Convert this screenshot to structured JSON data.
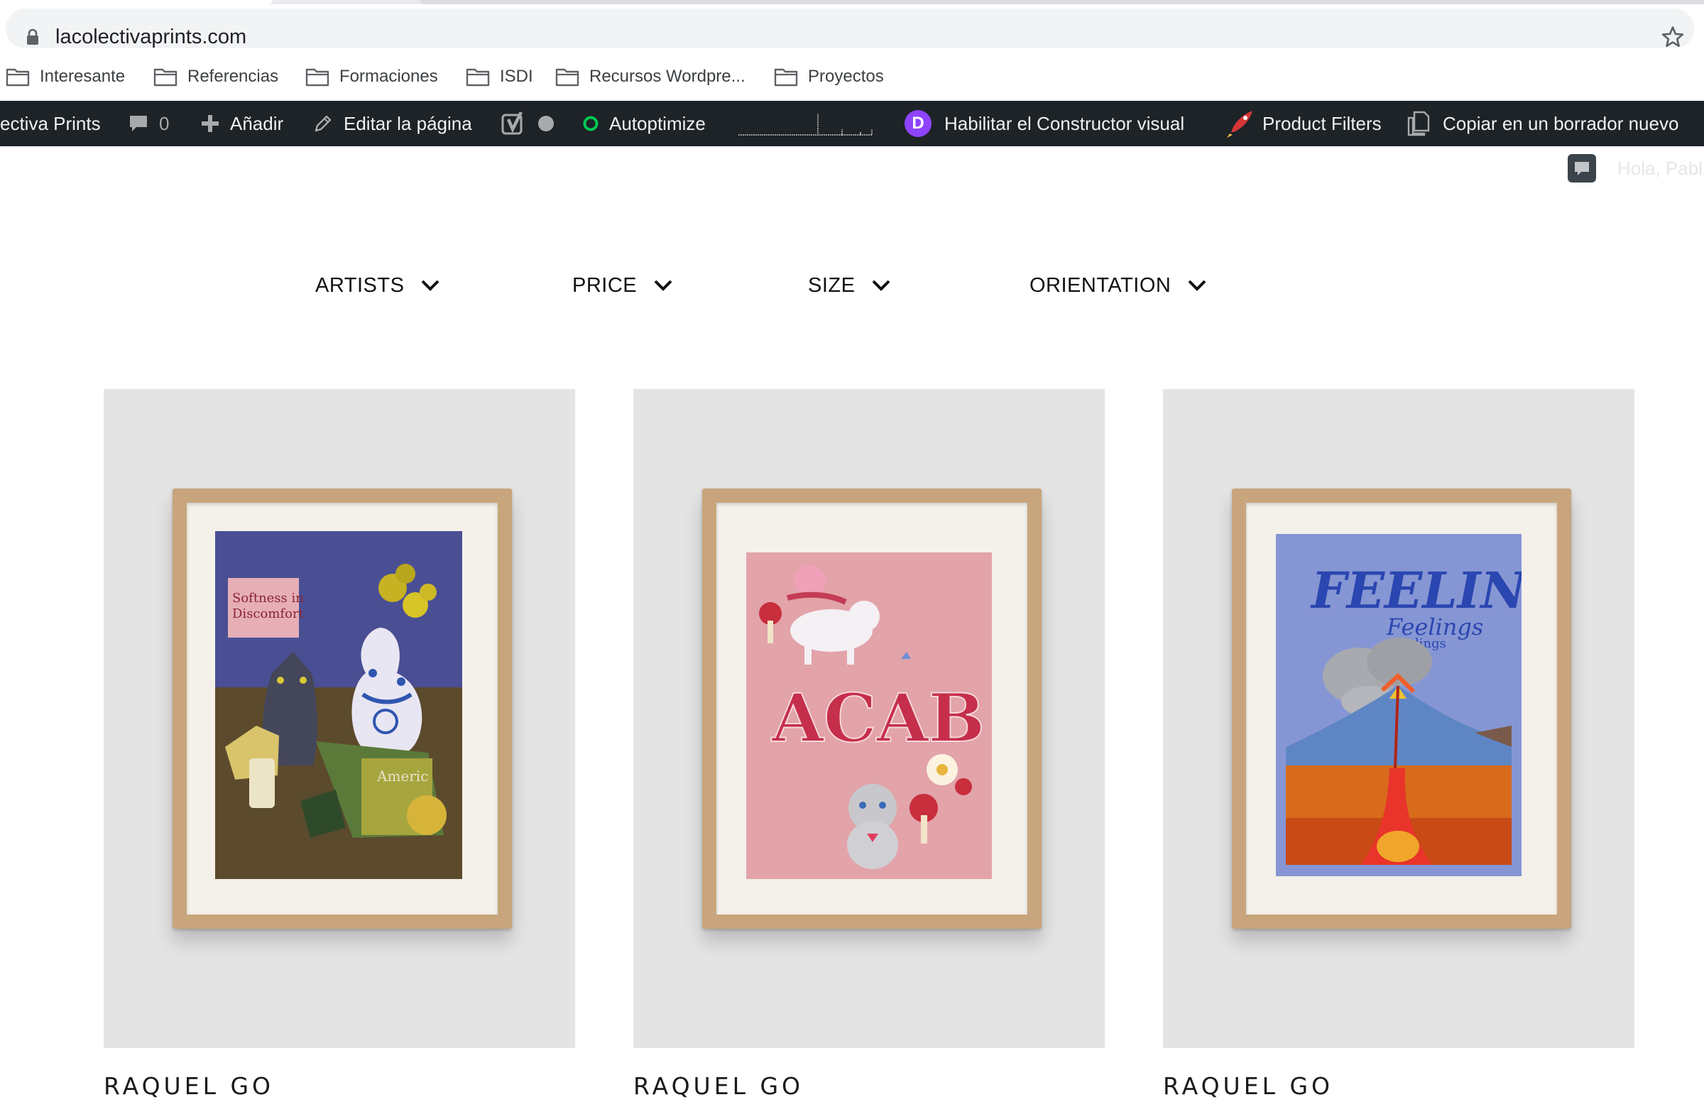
{
  "browser": {
    "url": "lacolectivaprints.com",
    "bookmarks": [
      "Interesante",
      "Referencias",
      "Formaciones",
      "ISDI",
      "Recursos Wordpre...",
      "Proyectos"
    ]
  },
  "adminbar": {
    "site_name": "ectiva Prints",
    "comments_count": "0",
    "add_label": "Añadir",
    "edit_label": "Editar la página",
    "autoptimize_label": "Autoptimize",
    "divi_label": "Habilitar el Constructor visual",
    "divi_badge": "D",
    "product_filters_label": "Product Filters",
    "copy_label": "Copiar en un borrador nuevo"
  },
  "page": {
    "greeting": "Hola, Pabl",
    "filters": [
      "ARTISTS",
      "PRICE",
      "SIZE",
      "ORIENTATION"
    ],
    "products": [
      {
        "artist": "RAQUEL GO",
        "art_text": [
          "Softness in",
          "Discomfort"
        ],
        "art_text2": "Americ"
      },
      {
        "artist": "RAQUEL GO",
        "art_text": [
          "ACAB"
        ]
      },
      {
        "artist": "RAQUEL GO",
        "art_text": [
          "FEELINGS",
          "Feelings",
          "feelings"
        ]
      }
    ]
  },
  "colors": {
    "adminbar_bg": "#1d2327",
    "autoptimize_dot": "#00c853",
    "divi_purple": "#8e44ff",
    "card_bg": "#e4e4e4"
  }
}
